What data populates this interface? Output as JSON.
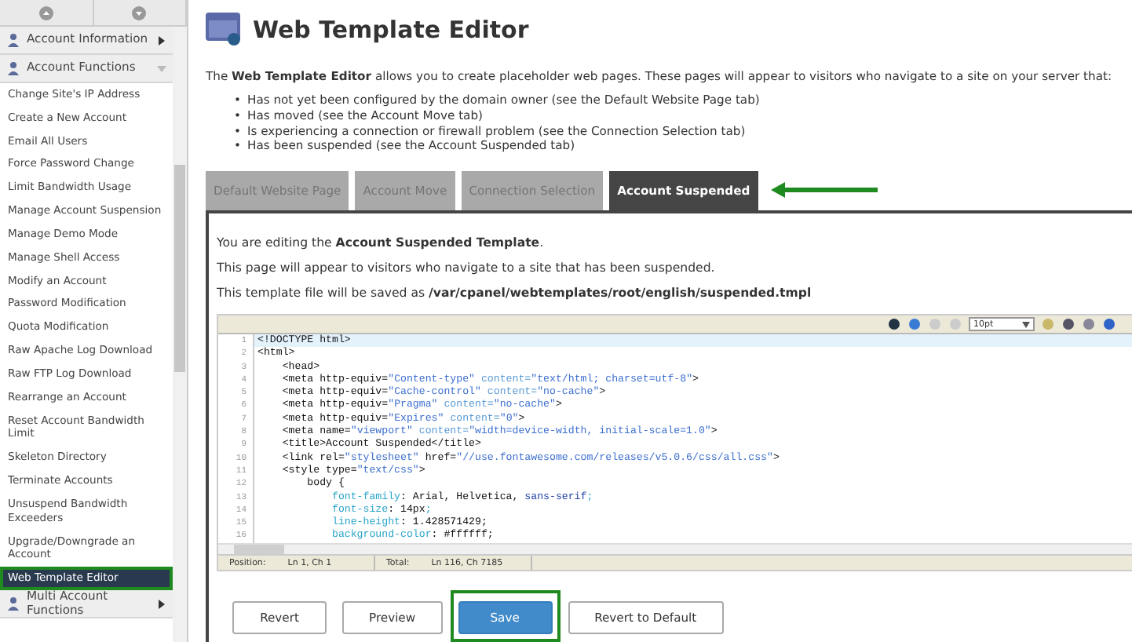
{
  "sidebar": {
    "sections": [
      {
        "label": "Account Information",
        "expanded": false
      },
      {
        "label": "Account Functions",
        "expanded": true,
        "items": [
          {
            "label": "Change Site's IP Address",
            "selected": false,
            "highlighted": false
          },
          {
            "label": "Create a New Account",
            "selected": false,
            "highlighted": false
          },
          {
            "label": "Email All Users",
            "selected": false,
            "highlighted": false
          },
          {
            "label": "Force Password Change",
            "selected": false,
            "highlighted": false
          },
          {
            "label": "Limit Bandwidth Usage",
            "selected": false,
            "highlighted": false
          },
          {
            "label": "Manage Account Suspension",
            "selected": false,
            "highlighted": false
          },
          {
            "label": "Manage Demo Mode",
            "selected": false,
            "highlighted": false
          },
          {
            "label": "Manage Shell Access",
            "selected": false,
            "highlighted": false
          },
          {
            "label": "Modify an Account",
            "selected": false,
            "highlighted": false
          },
          {
            "label": "Password Modification",
            "selected": false,
            "highlighted": false
          },
          {
            "label": "Quota Modification",
            "selected": false,
            "highlighted": false
          },
          {
            "label": "Raw Apache Log Download",
            "selected": false,
            "highlighted": false
          },
          {
            "label": "Raw FTP Log Download",
            "selected": false,
            "highlighted": false
          },
          {
            "label": "Rearrange an Account",
            "selected": false,
            "highlighted": false
          },
          {
            "label": "Reset Account Bandwidth Limit",
            "selected": false,
            "highlighted": false
          },
          {
            "label": "Skeleton Directory",
            "selected": false,
            "highlighted": false
          },
          {
            "label": "Terminate Accounts",
            "selected": false,
            "highlighted": false
          },
          {
            "label": "Unsuspend Bandwidth Exceeders",
            "selected": false,
            "highlighted": false
          },
          {
            "label": "Upgrade/Downgrade an Account",
            "selected": false,
            "highlighted": false
          },
          {
            "label": "Web Template Editor",
            "selected": true,
            "highlighted": true
          }
        ]
      },
      {
        "label": "Multi Account Functions",
        "expanded": false
      }
    ]
  },
  "page": {
    "title": "Web Template Editor",
    "intro": "The **Web Template Editor** allows you to create placeholder web pages. These pages will appear to visitors who navigate to a site on your server that:",
    "bullets": [
      {
        "marker": "•",
        "text": "Has not yet been configured by the domain owner (see the Default Website Page tab)"
      },
      {
        "marker": "•",
        "text": "Has moved (see the Account Move tab)"
      },
      {
        "marker": "•",
        "text": "Is experiencing a connection or firewall problem (see the Connection Selection tab)"
      },
      {
        "marker": "•",
        "text": "Has been suspended (see the Account Suspended tab)"
      }
    ]
  },
  "tabs": [
    {
      "label": "Default Website Page",
      "selected": false,
      "pointed": false
    },
    {
      "label": "Account Move",
      "selected": false,
      "pointed": false
    },
    {
      "label": "Connection Selection",
      "selected": false,
      "pointed": false
    },
    {
      "label": "Account Suspended",
      "selected": true,
      "pointed": true
    }
  ],
  "panel": {
    "lines": [
      "You are editing the **Account Suspended Template**.",
      "This page will appear to visitors who navigate to a site that has been suspended.",
      "This template file will be saved as **/var/cpanel/webtemplates/root/english/suspended.tmpl**"
    ]
  },
  "editor": {
    "font_size": "10pt",
    "code": [
      {
        "number": "1",
        "current": true,
        "tokens": [
          {
            "kind": "tag",
            "text": "<!DOCTYPE html>"
          }
        ]
      },
      {
        "number": "2",
        "current": false,
        "tokens": [
          {
            "kind": "tag",
            "text": "<html>"
          }
        ]
      },
      {
        "number": "3",
        "current": false,
        "tokens": [
          {
            "kind": "tag",
            "text": "    <head>"
          }
        ]
      },
      {
        "number": "4",
        "current": false,
        "tokens": [
          {
            "kind": "tag",
            "text": "    <meta http-equiv="
          },
          {
            "kind": "string",
            "text": "\"Content-type\""
          },
          {
            "kind": "attr",
            "text": " content="
          },
          {
            "kind": "string",
            "text": "\"text/html; charset=utf-8\""
          },
          {
            "kind": "tag",
            "text": ">"
          }
        ]
      },
      {
        "number": "5",
        "current": false,
        "tokens": [
          {
            "kind": "tag",
            "text": "    <meta http-equiv="
          },
          {
            "kind": "string",
            "text": "\"Cache-control\""
          },
          {
            "kind": "attr",
            "text": " content="
          },
          {
            "kind": "string",
            "text": "\"no-cache\""
          },
          {
            "kind": "tag",
            "text": ">"
          }
        ]
      },
      {
        "number": "6",
        "current": false,
        "tokens": [
          {
            "kind": "tag",
            "text": "    <meta http-equiv="
          },
          {
            "kind": "string",
            "text": "\"Pragma\""
          },
          {
            "kind": "attr",
            "text": " content="
          },
          {
            "kind": "string",
            "text": "\"no-cache\""
          },
          {
            "kind": "tag",
            "text": ">"
          }
        ]
      },
      {
        "number": "7",
        "current": false,
        "tokens": [
          {
            "kind": "tag",
            "text": "    <meta http-equiv="
          },
          {
            "kind": "string",
            "text": "\"Expires\""
          },
          {
            "kind": "attr",
            "text": " content="
          },
          {
            "kind": "string",
            "text": "\"0\""
          },
          {
            "kind": "tag",
            "text": ">"
          }
        ]
      },
      {
        "number": "8",
        "current": false,
        "tokens": [
          {
            "kind": "tag",
            "text": "    <meta name="
          },
          {
            "kind": "string",
            "text": "\"viewport\""
          },
          {
            "kind": "attr",
            "text": " content="
          },
          {
            "kind": "string",
            "text": "\"width=device-width, initial-scale=1.0\""
          },
          {
            "kind": "tag",
            "text": ">"
          }
        ]
      },
      {
        "number": "9",
        "current": false,
        "tokens": [
          {
            "kind": "tag",
            "text": "    <title>Account Suspended</title>"
          }
        ]
      },
      {
        "number": "10",
        "current": false,
        "tokens": [
          {
            "kind": "tag",
            "text": "    <link rel="
          },
          {
            "kind": "string",
            "text": "\"stylesheet\""
          },
          {
            "kind": "tag",
            "text": " href="
          },
          {
            "kind": "string",
            "text": "\"//use.fontawesome.com/releases/v5.0.6/css/all.css\""
          },
          {
            "kind": "tag",
            "text": ">"
          }
        ]
      },
      {
        "number": "11",
        "current": false,
        "tokens": [
          {
            "kind": "tag",
            "text": "    <style type="
          },
          {
            "kind": "string",
            "text": "\"text/css\""
          },
          {
            "kind": "tag",
            "text": ">"
          }
        ]
      },
      {
        "number": "12",
        "current": false,
        "tokens": [
          {
            "kind": "tag",
            "text": "        body {"
          }
        ]
      },
      {
        "number": "13",
        "current": false,
        "tokens": [
          {
            "kind": "prop",
            "text": "            font-family"
          },
          {
            "kind": "tag",
            "text": ": Arial, Helvetica, "
          },
          {
            "kind": "keyword",
            "text": "sans-serif"
          },
          {
            "kind": "prop",
            "text": ";"
          }
        ]
      },
      {
        "number": "14",
        "current": false,
        "tokens": [
          {
            "kind": "prop",
            "text": "            font-size"
          },
          {
            "kind": "tag",
            "text": ": 14px"
          },
          {
            "kind": "prop",
            "text": ";"
          }
        ]
      },
      {
        "number": "15",
        "current": false,
        "tokens": [
          {
            "kind": "prop",
            "text": "            line-height"
          },
          {
            "kind": "tag",
            "text": ": 1.428571429;"
          }
        ]
      },
      {
        "number": "16",
        "current": false,
        "tokens": [
          {
            "kind": "prop",
            "text": "            background-color"
          },
          {
            "kind": "tag",
            "text": ": #ffffff;"
          }
        ]
      }
    ],
    "status": [
      {
        "label": "Position:",
        "value": "Ln 1, Ch 1"
      },
      {
        "label": "Total:",
        "value": "Ln 116, Ch 7185"
      }
    ]
  },
  "buttons": [
    {
      "label": "Revert",
      "kind": "default",
      "highlighted": false
    },
    {
      "label": "Preview",
      "kind": "default",
      "highlighted": false
    },
    {
      "label": "Save",
      "kind": "primary",
      "highlighted": true
    },
    {
      "label": "Revert to Default",
      "kind": "default",
      "highlighted": false
    }
  ]
}
